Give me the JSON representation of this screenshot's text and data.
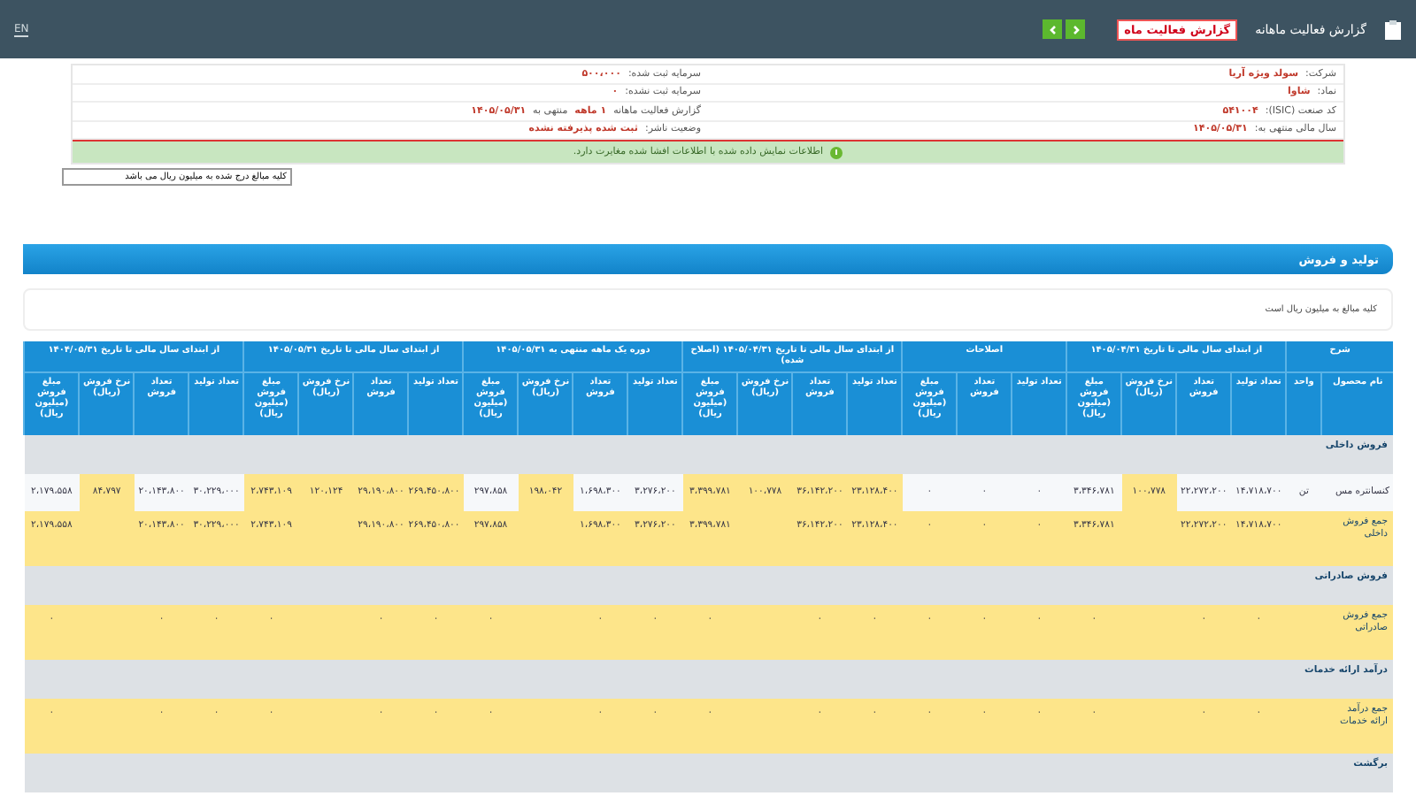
{
  "topbar": {
    "title": "گزارش فعالیت ماهانه",
    "badge": "گزارش فعالیت ماه",
    "language_link": "EN"
  },
  "info": {
    "columns": [
      [
        {
          "parts": [
            {
              "text": "شرکت:",
              "kind": "label"
            },
            {
              "text": "سولد ویژه آریا",
              "kind": "value"
            }
          ]
        },
        {
          "parts": [
            {
              "text": "نماد:",
              "kind": "label"
            },
            {
              "text": "شاوا",
              "kind": "value"
            }
          ]
        },
        {
          "parts": [
            {
              "text": "کد صنعت (ISIC):",
              "kind": "label"
            },
            {
              "text": "۵۴۱۰۰۴",
              "kind": "value"
            }
          ]
        },
        {
          "parts": [
            {
              "text": "سال مالی منتهی به:",
              "kind": "label"
            },
            {
              "text": "۱۴۰۵/۰۵/۳۱",
              "kind": "value"
            }
          ]
        }
      ],
      [
        {
          "parts": [
            {
              "text": "سرمایه ثبت شده:",
              "kind": "label"
            },
            {
              "text": "۵۰۰،۰۰۰",
              "kind": "value"
            }
          ]
        },
        {
          "parts": [
            {
              "text": "سرمایه ثبت نشده:",
              "kind": "label"
            },
            {
              "text": "۰",
              "kind": "value"
            }
          ]
        },
        {
          "parts": [
            {
              "text": "گزارش فعالیت ماهانه",
              "kind": "label"
            },
            {
              "text": "۱ ماهه",
              "kind": "value"
            },
            {
              "text": "منتهی به",
              "kind": "label"
            },
            {
              "text": "۱۴۰۵/۰۵/۳۱",
              "kind": "value"
            }
          ]
        },
        {
          "parts": [
            {
              "text": "وضعیت ناشر:",
              "kind": "label"
            },
            {
              "text": "ثبت شده پذیرفته نشده",
              "kind": "value"
            }
          ]
        }
      ]
    ],
    "notice": "اطلاعات نمایش داده شده با اطلاعات افشا شده مغایرت دارد."
  },
  "units_field": {
    "value": "کلیه مبالغ درج شده به میلیون ریال می باشد"
  },
  "section": {
    "title": "تولید و فروش",
    "note": "کلیه مبالغ به میلیون ریال است"
  },
  "table": {
    "groups": [
      {
        "label": "شرح",
        "columns": [
          "نام محصول",
          "واحد"
        ]
      },
      {
        "label": "از ابتدای سال مالی تا تاریخ ۱۴۰۵/۰۴/۳۱",
        "columns": [
          "تعداد تولید",
          "تعداد فروش",
          "نرخ فروش (ریال)",
          "مبلغ فروش (میلیون ریال)"
        ]
      },
      {
        "label": "اصلاحات",
        "columns": [
          "تعداد تولید",
          "تعداد فروش",
          "مبلغ فروش (میلیون ریال)"
        ]
      },
      {
        "label": "از ابتدای سال مالی تا تاریخ ۱۴۰۵/۰۴/۳۱ (اصلاح شده)",
        "columns": [
          "تعداد تولید",
          "تعداد فروش",
          "نرخ فروش (ریال)",
          "مبلغ فروش (میلیون ریال)"
        ]
      },
      {
        "label": "دوره یک ماهه منتهی به ۱۴۰۵/۰۵/۳۱",
        "columns": [
          "تعداد تولید",
          "تعداد فروش",
          "نرخ فروش (ریال)",
          "مبلغ فروش (میلیون ریال)"
        ]
      },
      {
        "label": "از ابتدای سال مالی تا تاریخ ۱۴۰۵/۰۵/۳۱",
        "columns": [
          "تعداد تولید",
          "تعداد فروش",
          "نرخ فروش (ریال)",
          "مبلغ فروش (میلیون ریال)"
        ]
      },
      {
        "label": "از ابتدای سال مالی تا تاریخ ۱۴۰۴/۰۵/۳۱",
        "columns": [
          "تعداد تولید",
          "تعداد فروش",
          "نرخ فروش (ریال)",
          "مبلغ فروش (میلیون ریال)"
        ]
      }
    ],
    "rows": [
      {
        "kind": "group",
        "label": "فروش داخلی"
      },
      {
        "kind": "item",
        "cells": [
          {
            "text": "کنسانتره مس",
            "highlighted": false
          },
          {
            "text": "تن",
            "highlighted": false
          },
          {
            "text": "۱۴،۷۱۸،۷۰۰",
            "highlighted": false
          },
          {
            "text": "۲۲،۲۷۲،۲۰۰",
            "highlighted": false
          },
          {
            "text": "۱۰۰،۷۷۸",
            "highlighted": true
          },
          {
            "text": "۳،۳۴۶،۷۸۱",
            "highlighted": false
          },
          {
            "text": "۰",
            "highlighted": false
          },
          {
            "text": "۰",
            "highlighted": false
          },
          {
            "text": "۰",
            "highlighted": false
          },
          {
            "text": "۲۳،۱۲۸،۴۰۰",
            "highlighted": true
          },
          {
            "text": "۳۶،۱۴۲،۲۰۰",
            "highlighted": true
          },
          {
            "text": "۱۰۰،۷۷۸",
            "highlighted": true
          },
          {
            "text": "۳،۳۹۹،۷۸۱",
            "highlighted": true
          },
          {
            "text": "۳،۲۷۶،۲۰۰",
            "highlighted": false
          },
          {
            "text": "۱،۶۹۸،۳۰۰",
            "highlighted": false
          },
          {
            "text": "۱۹۸،۰۴۲",
            "highlighted": true
          },
          {
            "text": "۲۹۷،۸۵۸",
            "highlighted": false
          },
          {
            "text": "۲۶۹،۴۵۰،۸۰۰",
            "highlighted": true
          },
          {
            "text": "۲۹،۱۹۰،۸۰۰",
            "highlighted": true
          },
          {
            "text": "۱۲۰،۱۲۴",
            "highlighted": true
          },
          {
            "text": "۲،۷۴۳،۱۰۹",
            "highlighted": true
          },
          {
            "text": "۳۰،۲۲۹،۰۰۰",
            "highlighted": false
          },
          {
            "text": "۲۰،۱۴۳،۸۰۰",
            "highlighted": false
          },
          {
            "text": "۸۴،۷۹۷",
            "highlighted": true
          },
          {
            "text": "۲،۱۷۹،۵۵۸",
            "highlighted": false
          }
        ]
      },
      {
        "kind": "total",
        "cells": [
          "جمع فروش داخلی",
          null,
          "۱۴،۷۱۸،۷۰۰",
          "۲۲،۲۷۲،۲۰۰",
          null,
          "۳،۳۴۶،۷۸۱",
          "۰",
          "۰",
          "۰",
          "۲۳،۱۲۸،۴۰۰",
          "۳۶،۱۴۲،۲۰۰",
          null,
          "۳،۳۹۹،۷۸۱",
          "۳،۲۷۶،۲۰۰",
          "۱،۶۹۸،۳۰۰",
          null,
          "۲۹۷،۸۵۸",
          "۲۶۹،۴۵۰،۸۰۰",
          "۲۹،۱۹۰،۸۰۰",
          null,
          "۲،۷۴۳،۱۰۹",
          "۳۰،۲۲۹،۰۰۰",
          "۲۰،۱۴۳،۸۰۰",
          null,
          "۲،۱۷۹،۵۵۸"
        ]
      },
      {
        "kind": "group",
        "label": "فروش صادراتی"
      },
      {
        "kind": "total",
        "cells": [
          "جمع فروش صادراتی",
          null,
          "۰",
          "۰",
          null,
          "۰",
          "۰",
          "۰",
          "۰",
          "۰",
          "۰",
          null,
          "۰",
          "۰",
          "۰",
          null,
          "۰",
          "۰",
          "۰",
          null,
          "۰",
          "۰",
          "۰",
          null,
          "۰"
        ]
      },
      {
        "kind": "group",
        "label": "درآمد ارائه خدمات"
      },
      {
        "kind": "total",
        "cells": [
          "جمع درآمد ارائه خدمات",
          null,
          "۰",
          "۰",
          null,
          "۰",
          "۰",
          "۰",
          "۰",
          "۰",
          "۰",
          null,
          "۰",
          "۰",
          "۰",
          null,
          "۰",
          "۰",
          "۰",
          null,
          "۰",
          "۰",
          "۰",
          null,
          "۰"
        ]
      },
      {
        "kind": "group",
        "label": "برگشت"
      }
    ]
  }
}
